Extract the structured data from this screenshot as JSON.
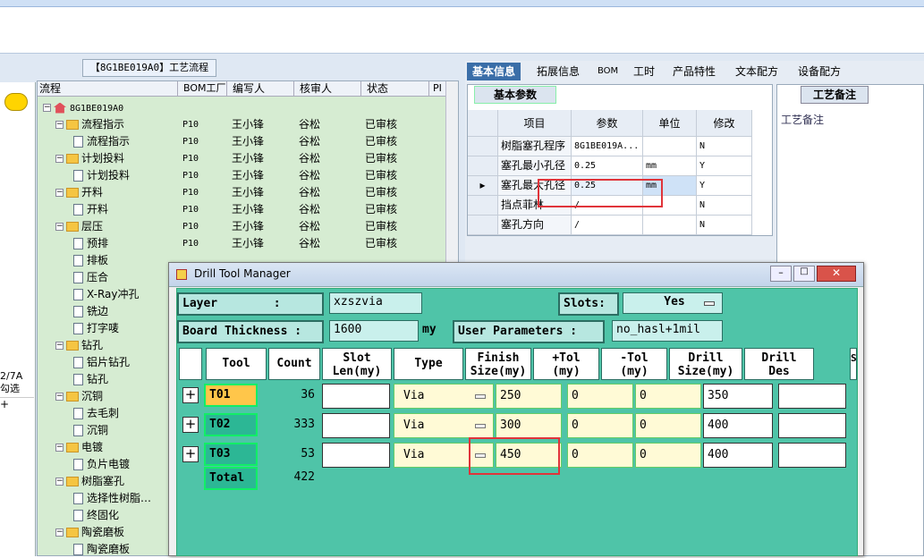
{
  "flow_panel": {
    "title": "【8G1BE019A0】工艺流程",
    "headers": [
      "流程",
      "BOM工厂",
      "编写人",
      "核审人",
      "状态",
      "PI"
    ],
    "root": "8G1BE019A0",
    "rows": [
      {
        "level": 1,
        "type": "folder",
        "name": "流程指示",
        "bom": "P10",
        "author": "王小锋",
        "reviewer": "谷松",
        "status": "已审核"
      },
      {
        "level": 2,
        "type": "doc",
        "name": "流程指示",
        "bom": "P10",
        "author": "王小锋",
        "reviewer": "谷松",
        "status": "已审核"
      },
      {
        "level": 1,
        "type": "folder",
        "name": "计划投料",
        "bom": "P10",
        "author": "王小锋",
        "reviewer": "谷松",
        "status": "已审核"
      },
      {
        "level": 2,
        "type": "doc",
        "name": "计划投料",
        "bom": "P10",
        "author": "王小锋",
        "reviewer": "谷松",
        "status": "已审核"
      },
      {
        "level": 1,
        "type": "folder",
        "name": "开料",
        "bom": "P10",
        "author": "王小锋",
        "reviewer": "谷松",
        "status": "已审核"
      },
      {
        "level": 2,
        "type": "doc",
        "name": "开料",
        "bom": "P10",
        "author": "王小锋",
        "reviewer": "谷松",
        "status": "已审核"
      },
      {
        "level": 1,
        "type": "folder",
        "name": "层压",
        "bom": "P10",
        "author": "王小锋",
        "reviewer": "谷松",
        "status": "已审核"
      },
      {
        "level": 2,
        "type": "doc",
        "name": "预排",
        "bom": "P10",
        "author": "王小锋",
        "reviewer": "谷松",
        "status": "已审核"
      },
      {
        "level": 2,
        "type": "doc",
        "name": "排板",
        "bom": "",
        "author": "",
        "reviewer": "",
        "status": ""
      },
      {
        "level": 2,
        "type": "doc",
        "name": "压合",
        "bom": "",
        "author": "",
        "reviewer": "",
        "status": ""
      },
      {
        "level": 2,
        "type": "doc",
        "name": "X-Ray冲孔",
        "bom": "",
        "author": "",
        "reviewer": "",
        "status": ""
      },
      {
        "level": 2,
        "type": "doc",
        "name": "铣边",
        "bom": "",
        "author": "",
        "reviewer": "",
        "status": ""
      },
      {
        "level": 2,
        "type": "doc",
        "name": "打字唛",
        "bom": "",
        "author": "",
        "reviewer": "",
        "status": ""
      },
      {
        "level": 1,
        "type": "folder",
        "name": "钻孔",
        "bom": "",
        "author": "",
        "reviewer": "",
        "status": ""
      },
      {
        "level": 2,
        "type": "doc",
        "name": "铝片钻孔",
        "bom": "",
        "author": "",
        "reviewer": "",
        "status": ""
      },
      {
        "level": 2,
        "type": "doc",
        "name": "钻孔",
        "bom": "",
        "author": "",
        "reviewer": "",
        "status": ""
      },
      {
        "level": 1,
        "type": "folder",
        "name": "沉铜",
        "bom": "",
        "author": "",
        "reviewer": "",
        "status": ""
      },
      {
        "level": 2,
        "type": "doc",
        "name": "去毛刺",
        "bom": "",
        "author": "",
        "reviewer": "",
        "status": ""
      },
      {
        "level": 2,
        "type": "doc",
        "name": "沉铜",
        "bom": "",
        "author": "",
        "reviewer": "",
        "status": ""
      },
      {
        "level": 1,
        "type": "folder",
        "name": "电镀",
        "bom": "",
        "author": "",
        "reviewer": "",
        "status": ""
      },
      {
        "level": 2,
        "type": "doc",
        "name": "负片电镀",
        "bom": "",
        "author": "",
        "reviewer": "",
        "status": ""
      },
      {
        "level": 1,
        "type": "folder",
        "name": "树脂塞孔",
        "bom": "",
        "author": "",
        "reviewer": "",
        "status": ""
      },
      {
        "level": 2,
        "type": "doc",
        "name": "选择性树脂…",
        "bom": "",
        "author": "",
        "reviewer": "",
        "status": ""
      },
      {
        "level": 2,
        "type": "doc",
        "name": "终固化",
        "bom": "",
        "author": "",
        "reviewer": "",
        "status": ""
      },
      {
        "level": 1,
        "type": "folder",
        "name": "陶瓷磨板",
        "bom": "",
        "author": "",
        "reviewer": "",
        "status": ""
      },
      {
        "level": 2,
        "type": "doc",
        "name": "陶瓷磨板",
        "bom": "",
        "author": "",
        "reviewer": "",
        "status": ""
      }
    ],
    "left_stub": {
      "code": "2/7A",
      "select": "勾选",
      "plus": "+"
    }
  },
  "right_tabs": [
    "基本信息",
    "拓展信息",
    "BOM",
    "工时",
    "产品特性",
    "文本配方",
    "设备配方"
  ],
  "basic_params": {
    "section_label": "基本参数",
    "headers": [
      "项目",
      "参数",
      "单位",
      "修改"
    ],
    "rows": [
      {
        "item": "树脂塞孔程序",
        "param": "8G1BE019A...",
        "unit": "",
        "edit": "N"
      },
      {
        "item": "塞孔最小孔径",
        "param": "0.25",
        "unit": "mm",
        "edit": "Y"
      },
      {
        "item": "塞孔最大孔径",
        "param": "0.25",
        "unit": "mm",
        "edit": "Y"
      },
      {
        "item": "挡点菲林",
        "param": "/",
        "unit": "",
        "edit": "N"
      },
      {
        "item": "塞孔方向",
        "param": "/",
        "unit": "",
        "edit": "N"
      }
    ]
  },
  "notes_panel": {
    "tab": "工艺备注",
    "label": "工艺备注"
  },
  "dialog": {
    "title": "Drill Tool Manager",
    "layer_label": "Layer        :",
    "layer_value": "xzszvia",
    "slots_label": "Slots:",
    "slots_value": "Yes",
    "thickness_label": "Board Thickness :",
    "thickness_value": "1600",
    "thickness_unit": "my",
    "user_params_label": "User Parameters :",
    "user_params_value": "no_hasl+1mil",
    "grid_headers": [
      "Tool",
      "Count",
      "Slot\nLen(my)",
      "Type",
      "Finish\nSize(my)",
      "+Tol\n(my)",
      "-Tol\n(my)",
      "Drill\nSize(my)",
      "Drill\nDes"
    ],
    "tools": [
      {
        "tool": "T01",
        "count": "36",
        "slot_len": "",
        "type": "Via",
        "finish": "250",
        "ptol": "0",
        "mtol": "0",
        "drill": "350",
        "des": ""
      },
      {
        "tool": "T02",
        "count": "333",
        "slot_len": "",
        "type": "Via",
        "finish": "300",
        "ptol": "0",
        "mtol": "0",
        "drill": "400",
        "des": ""
      },
      {
        "tool": "T03",
        "count": "53",
        "slot_len": "",
        "type": "Via",
        "finish": "450",
        "ptol": "0",
        "mtol": "0",
        "drill": "400",
        "des": ""
      }
    ],
    "total_label": "Total",
    "total_count": "422"
  }
}
